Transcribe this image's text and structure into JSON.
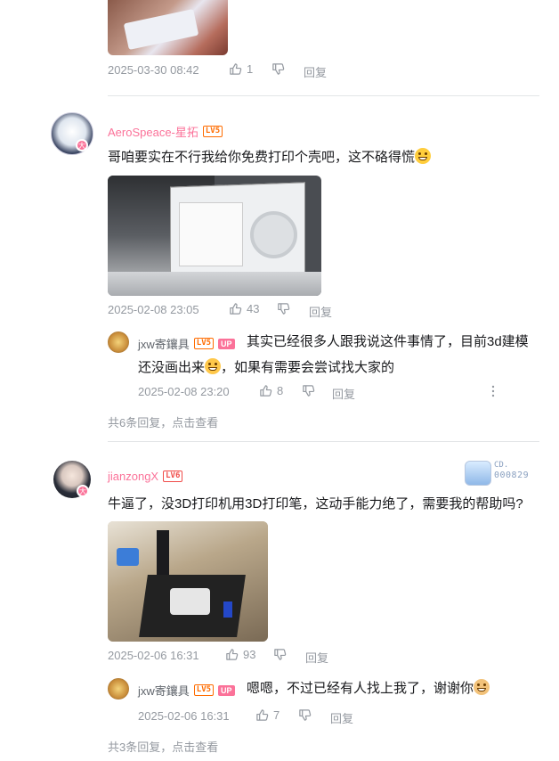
{
  "comments": [
    {
      "time": "2025-03-30 08:42",
      "likes": "1",
      "reply_label": "回复"
    },
    {
      "username": "AeroSpeace-星拓",
      "level": "LV5",
      "text": "哥咱要实在不行我给你免费打印个壳吧，这不硌得慌",
      "emoji": "grinning-emoji",
      "time": "2025-02-08 23:05",
      "likes": "43",
      "reply_label": "回复",
      "reply": {
        "username": "jxw寄鑲具",
        "level": "LV5",
        "up_badge": "UP",
        "text_line1": "其实已经很多人跟我说这件事情了，目前3d建模",
        "text_line2a": "还没画出来",
        "text_line2b": "，如果有需要会尝试找大家的",
        "emoji": "sweat-emoji",
        "time": "2025-02-08 23:20",
        "likes": "8",
        "reply_label": "回复"
      },
      "more_replies": "共6条回复，点击查看"
    },
    {
      "username": "jianzongX",
      "level": "LV6",
      "text": "牛逼了，没3D打印机用3D打印笔，这动手能力绝了，需要我的帮助吗?",
      "decoration_id": "000829",
      "decoration_prefix": "CD.",
      "time": "2025-02-06 16:31",
      "likes": "93",
      "reply_label": "回复",
      "reply": {
        "username": "jxw寄鑲具",
        "level": "LV5",
        "up_badge": "UP",
        "text": "嗯嗯，不过已经有人找上我了，谢谢你",
        "emoji": "dog-emoji",
        "time": "2025-02-06 16:31",
        "likes": "7",
        "reply_label": "回复"
      },
      "more_replies": "共3条回复，点击查看"
    }
  ],
  "colors": {
    "accent_pink": "#fb7299",
    "meta_gray": "#9499a0",
    "text": "#18191c",
    "divider": "#e3e5e7",
    "level_orange": "#ff6c00"
  }
}
